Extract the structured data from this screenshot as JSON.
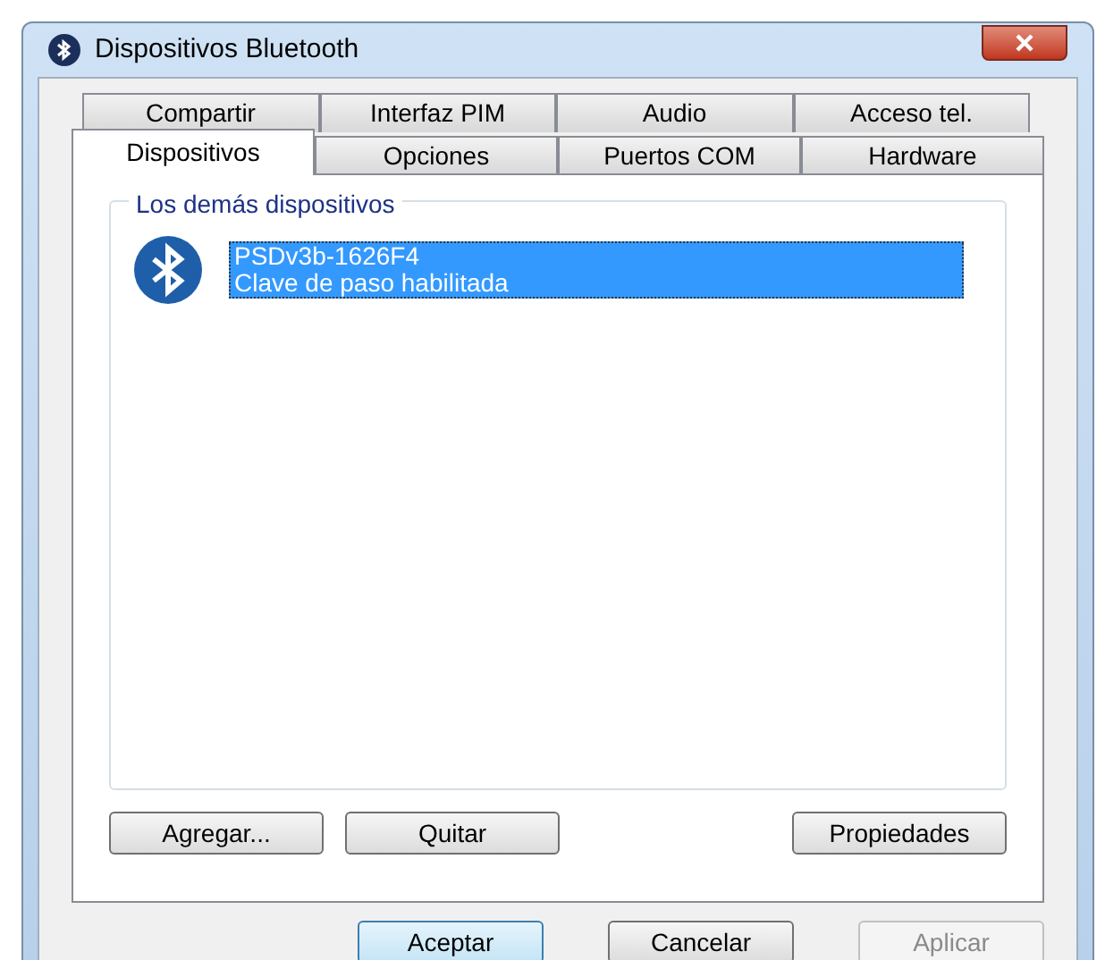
{
  "window": {
    "title": "Dispositivos Bluetooth"
  },
  "tab_rows": [
    [
      {
        "label": "Compartir",
        "selected": false
      },
      {
        "label": "Interfaz PIM",
        "selected": false
      },
      {
        "label": "Audio",
        "selected": false
      },
      {
        "label": "Acceso tel.",
        "selected": false
      }
    ],
    [
      {
        "label": "Dispositivos",
        "selected": true
      },
      {
        "label": "Opciones",
        "selected": false
      },
      {
        "label": "Puertos COM",
        "selected": false
      },
      {
        "label": "Hardware",
        "selected": false
      }
    ]
  ],
  "group": {
    "title": "Los demás dispositivos",
    "devices": [
      {
        "name": "PSDv3b-1626F4",
        "status": "Clave de paso habilitada",
        "selected": true
      }
    ]
  },
  "panel_buttons": [
    {
      "label": "Agregar..."
    },
    {
      "label": "Quitar"
    },
    {
      "label": "Propiedades"
    }
  ],
  "dialog_buttons": [
    {
      "label": "Aceptar",
      "default": true,
      "disabled": false
    },
    {
      "label": "Cancelar",
      "default": false,
      "disabled": false
    },
    {
      "label": "Aplicar",
      "default": false,
      "disabled": true
    }
  ]
}
